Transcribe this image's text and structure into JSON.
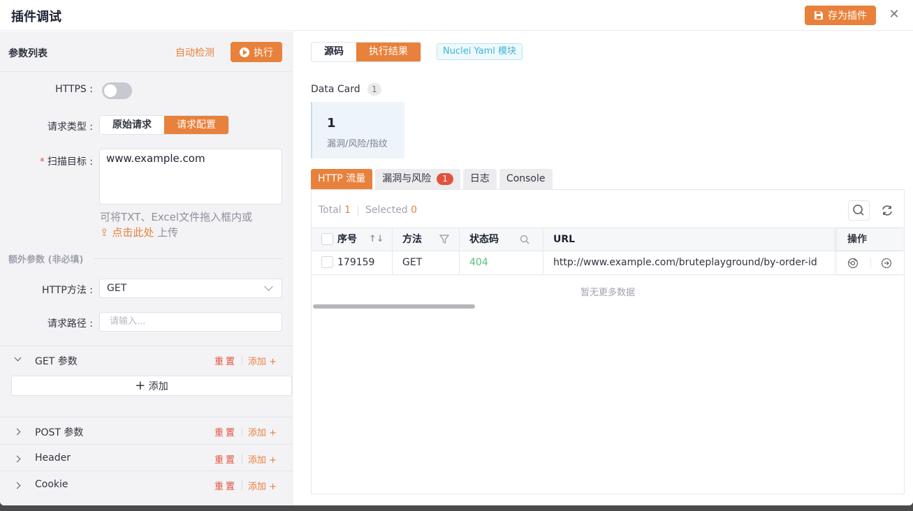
{
  "header": {
    "title": "插件调试",
    "save_label": "存为插件"
  },
  "left": {
    "param_list_label": "参数列表",
    "auto_detect": "自动检测",
    "execute_label": "执行",
    "https_label": "HTTPS :",
    "https_enabled": false,
    "request_type_label": "请求类型 :",
    "request_type_options": [
      "原始请求",
      "请求配置"
    ],
    "request_type_selected": "请求配置",
    "scan_target_label": "扫描目标 :",
    "scan_target_value": "www.example.com",
    "hint_text": "可将TXT、Excel文件拖入框内或",
    "hint_link": "点击此处",
    "hint_suffix": "上传",
    "extra_params_title": "额外参数 (非必填)",
    "http_method_label": "HTTP方法 :",
    "http_method_value": "GET",
    "request_path_label": "请求路径 :",
    "request_path_placeholder": "请输入...",
    "sections": [
      {
        "title": "GET 参数",
        "reset": "重置",
        "add": "添加 +"
      },
      {
        "title": "POST 参数",
        "reset": "重置",
        "add": "添加 +"
      },
      {
        "title": "Header",
        "reset": "重置",
        "add": "添加 +"
      },
      {
        "title": "Cookie",
        "reset": "重置",
        "add": "添加 +"
      }
    ],
    "add_row_label": "添加"
  },
  "right": {
    "tabs": [
      "源码",
      "执行结果"
    ],
    "active_tab": "执行结果",
    "nuclei_tag": "Nuclei Yaml 模块",
    "data_card_label": "Data Card",
    "data_card_count": "1",
    "card_value": "1",
    "card_text": "漏洞/风险/指纹",
    "subtabs": [
      "HTTP 流量",
      "漏洞与风险",
      "日志",
      "Console"
    ],
    "risk_badge": "1",
    "total_label": "Total",
    "total_value": "1",
    "selected_label": "Selected",
    "selected_value": "0",
    "columns": [
      "序号",
      "方法",
      "状态码",
      "URL",
      "操作"
    ],
    "rows": [
      {
        "id": "179159",
        "method": "GET",
        "status": "404",
        "url": "http://www.example.com/bruteplayground/by-order-id"
      }
    ],
    "no_more": "暂无更多数据"
  },
  "colors": {
    "accent": "#e8813b",
    "danger": "#e2533e",
    "status_ok": "#56c07a",
    "info": "#3fb5d6"
  }
}
